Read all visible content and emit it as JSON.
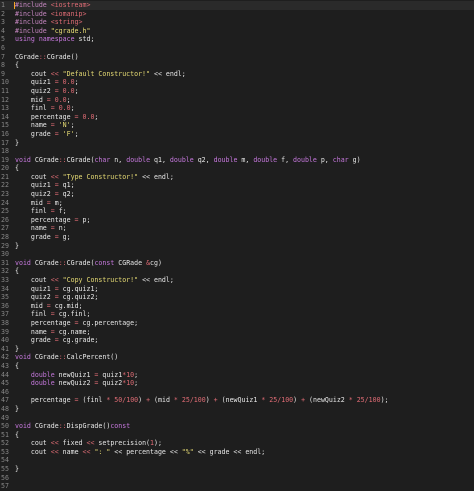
{
  "editor": {
    "theme": {
      "background": "#1e1e1e",
      "line_number": "#858585",
      "string": "#e6db74",
      "keyword": "#c678dd",
      "number": "#e06c75"
    },
    "lines": [
      [
        {
          "t": "#include ",
          "c": "pp"
        },
        {
          "t": "<iostream>",
          "c": "op"
        }
      ],
      [
        {
          "t": "#include ",
          "c": "pp"
        },
        {
          "t": "<iomanip>",
          "c": "op"
        }
      ],
      [
        {
          "t": "#include ",
          "c": "pp"
        },
        {
          "t": "<string>",
          "c": "op"
        }
      ],
      [
        {
          "t": "#include ",
          "c": "pp"
        },
        {
          "t": "\"cgrade.h\"",
          "c": "str"
        }
      ],
      [
        {
          "t": "using namespace ",
          "c": "kw2"
        },
        {
          "t": "std;",
          "c": "plain"
        }
      ],
      [],
      [
        {
          "t": "CGrade",
          "c": "plain"
        },
        {
          "t": "::",
          "c": "op"
        },
        {
          "t": "CGrade()",
          "c": "plain"
        }
      ],
      [
        {
          "t": "{",
          "c": "plain"
        }
      ],
      [
        {
          "t": "    cout ",
          "c": "plain"
        },
        {
          "t": "<< ",
          "c": "op"
        },
        {
          "t": "\"Default Constructor!\"",
          "c": "str"
        },
        {
          "t": " << endl;",
          "c": "plain"
        }
      ],
      [
        {
          "t": "    quiz1 ",
          "c": "plain"
        },
        {
          "t": "= ",
          "c": "op"
        },
        {
          "t": "0.0",
          "c": "num"
        },
        {
          "t": ";",
          "c": "plain"
        }
      ],
      [
        {
          "t": "    quiz2 ",
          "c": "plain"
        },
        {
          "t": "= ",
          "c": "op"
        },
        {
          "t": "0.0",
          "c": "num"
        },
        {
          "t": ";",
          "c": "plain"
        }
      ],
      [
        {
          "t": "    mid ",
          "c": "plain"
        },
        {
          "t": "= ",
          "c": "op"
        },
        {
          "t": "0.0",
          "c": "num"
        },
        {
          "t": ";",
          "c": "plain"
        }
      ],
      [
        {
          "t": "    finl ",
          "c": "plain"
        },
        {
          "t": "= ",
          "c": "op"
        },
        {
          "t": "0.0",
          "c": "num"
        },
        {
          "t": ";",
          "c": "plain"
        }
      ],
      [
        {
          "t": "    percentage ",
          "c": "plain"
        },
        {
          "t": "= ",
          "c": "op"
        },
        {
          "t": "0.0",
          "c": "num"
        },
        {
          "t": ";",
          "c": "plain"
        }
      ],
      [
        {
          "t": "    name ",
          "c": "plain"
        },
        {
          "t": "= ",
          "c": "op"
        },
        {
          "t": "'N'",
          "c": "str"
        },
        {
          "t": ";",
          "c": "plain"
        }
      ],
      [
        {
          "t": "    grade ",
          "c": "plain"
        },
        {
          "t": "= ",
          "c": "op"
        },
        {
          "t": "'F'",
          "c": "str"
        },
        {
          "t": ";",
          "c": "plain"
        }
      ],
      [
        {
          "t": "}",
          "c": "plain"
        }
      ],
      [],
      [
        {
          "t": "void ",
          "c": "kw2"
        },
        {
          "t": "CGrade",
          "c": "plain"
        },
        {
          "t": "::",
          "c": "op"
        },
        {
          "t": "CGrade(",
          "c": "plain"
        },
        {
          "t": "char ",
          "c": "kw2"
        },
        {
          "t": "n, ",
          "c": "plain"
        },
        {
          "t": "double ",
          "c": "kw2"
        },
        {
          "t": "q1, ",
          "c": "plain"
        },
        {
          "t": "double ",
          "c": "kw2"
        },
        {
          "t": "q2, ",
          "c": "plain"
        },
        {
          "t": "double ",
          "c": "kw2"
        },
        {
          "t": "m, ",
          "c": "plain"
        },
        {
          "t": "double ",
          "c": "kw2"
        },
        {
          "t": "f, ",
          "c": "plain"
        },
        {
          "t": "double ",
          "c": "kw2"
        },
        {
          "t": "p, ",
          "c": "plain"
        },
        {
          "t": "char ",
          "c": "kw2"
        },
        {
          "t": "g)",
          "c": "plain"
        }
      ],
      [
        {
          "t": "{",
          "c": "plain"
        }
      ],
      [
        {
          "t": "    cout ",
          "c": "plain"
        },
        {
          "t": "<< ",
          "c": "op"
        },
        {
          "t": "\"Type Constructor!\"",
          "c": "str"
        },
        {
          "t": " << endl;",
          "c": "plain"
        }
      ],
      [
        {
          "t": "    quiz1 ",
          "c": "plain"
        },
        {
          "t": "= ",
          "c": "op"
        },
        {
          "t": "q1;",
          "c": "plain"
        }
      ],
      [
        {
          "t": "    quiz2 ",
          "c": "plain"
        },
        {
          "t": "= ",
          "c": "op"
        },
        {
          "t": "q2;",
          "c": "plain"
        }
      ],
      [
        {
          "t": "    mid ",
          "c": "plain"
        },
        {
          "t": "= ",
          "c": "op"
        },
        {
          "t": "m;",
          "c": "plain"
        }
      ],
      [
        {
          "t": "    finl ",
          "c": "plain"
        },
        {
          "t": "= ",
          "c": "op"
        },
        {
          "t": "f;",
          "c": "plain"
        }
      ],
      [
        {
          "t": "    percentage ",
          "c": "plain"
        },
        {
          "t": "= ",
          "c": "op"
        },
        {
          "t": "p;",
          "c": "plain"
        }
      ],
      [
        {
          "t": "    name ",
          "c": "plain"
        },
        {
          "t": "= ",
          "c": "op"
        },
        {
          "t": "n;",
          "c": "plain"
        }
      ],
      [
        {
          "t": "    grade ",
          "c": "plain"
        },
        {
          "t": "= ",
          "c": "op"
        },
        {
          "t": "g;",
          "c": "plain"
        }
      ],
      [
        {
          "t": "}",
          "c": "plain"
        }
      ],
      [],
      [
        {
          "t": "void ",
          "c": "kw2"
        },
        {
          "t": "CGrade",
          "c": "plain"
        },
        {
          "t": "::",
          "c": "op"
        },
        {
          "t": "CGrade(",
          "c": "plain"
        },
        {
          "t": "const ",
          "c": "kw2"
        },
        {
          "t": "CGRade ",
          "c": "plain"
        },
        {
          "t": "&",
          "c": "op"
        },
        {
          "t": "cg)",
          "c": "plain"
        }
      ],
      [
        {
          "t": "{",
          "c": "plain"
        }
      ],
      [
        {
          "t": "    cout ",
          "c": "plain"
        },
        {
          "t": "<< ",
          "c": "op"
        },
        {
          "t": "\"Copy Constructor!\"",
          "c": "str"
        },
        {
          "t": " << endl;",
          "c": "plain"
        }
      ],
      [
        {
          "t": "    quiz1 ",
          "c": "plain"
        },
        {
          "t": "= ",
          "c": "op"
        },
        {
          "t": "cg.quiz1;",
          "c": "plain"
        }
      ],
      [
        {
          "t": "    quiz2 ",
          "c": "plain"
        },
        {
          "t": "= ",
          "c": "op"
        },
        {
          "t": "cg.quiz2;",
          "c": "plain"
        }
      ],
      [
        {
          "t": "    mid ",
          "c": "plain"
        },
        {
          "t": "= ",
          "c": "op"
        },
        {
          "t": "cg.mid;",
          "c": "plain"
        }
      ],
      [
        {
          "t": "    finl ",
          "c": "plain"
        },
        {
          "t": "= ",
          "c": "op"
        },
        {
          "t": "cg.finl;",
          "c": "plain"
        }
      ],
      [
        {
          "t": "    percentage ",
          "c": "plain"
        },
        {
          "t": "= ",
          "c": "op"
        },
        {
          "t": "cg.percentage;",
          "c": "plain"
        }
      ],
      [
        {
          "t": "    name ",
          "c": "plain"
        },
        {
          "t": "= ",
          "c": "op"
        },
        {
          "t": "cg.name;",
          "c": "plain"
        }
      ],
      [
        {
          "t": "    grade ",
          "c": "plain"
        },
        {
          "t": "= ",
          "c": "op"
        },
        {
          "t": "cg.grade;",
          "c": "plain"
        }
      ],
      [
        {
          "t": "}",
          "c": "plain"
        }
      ],
      [
        {
          "t": "void ",
          "c": "kw2"
        },
        {
          "t": "CGrade",
          "c": "plain"
        },
        {
          "t": "::",
          "c": "op"
        },
        {
          "t": "CalcPercent()",
          "c": "plain"
        }
      ],
      [
        {
          "t": "{",
          "c": "plain"
        }
      ],
      [
        {
          "t": "    double ",
          "c": "kw2"
        },
        {
          "t": "newQuiz1 ",
          "c": "plain"
        },
        {
          "t": "= ",
          "c": "op"
        },
        {
          "t": "quiz1",
          "c": "plain"
        },
        {
          "t": "*",
          "c": "op"
        },
        {
          "t": "10",
          "c": "num"
        },
        {
          "t": ";",
          "c": "plain"
        }
      ],
      [
        {
          "t": "    double ",
          "c": "kw2"
        },
        {
          "t": "newQuiz2 ",
          "c": "plain"
        },
        {
          "t": "= ",
          "c": "op"
        },
        {
          "t": "quiz2",
          "c": "plain"
        },
        {
          "t": "*",
          "c": "op"
        },
        {
          "t": "10",
          "c": "num"
        },
        {
          "t": ";",
          "c": "plain"
        }
      ],
      [],
      [
        {
          "t": "    percentage ",
          "c": "plain"
        },
        {
          "t": "= ",
          "c": "op"
        },
        {
          "t": "(finl ",
          "c": "plain"
        },
        {
          "t": "* ",
          "c": "op"
        },
        {
          "t": "50",
          "c": "num"
        },
        {
          "t": "/",
          "c": "op"
        },
        {
          "t": "100",
          "c": "num"
        },
        {
          "t": ") ",
          "c": "plain"
        },
        {
          "t": "+ ",
          "c": "op"
        },
        {
          "t": "(mid ",
          "c": "plain"
        },
        {
          "t": "* ",
          "c": "op"
        },
        {
          "t": "25",
          "c": "num"
        },
        {
          "t": "/",
          "c": "op"
        },
        {
          "t": "100",
          "c": "num"
        },
        {
          "t": ") ",
          "c": "plain"
        },
        {
          "t": "+ ",
          "c": "op"
        },
        {
          "t": "(newQuiz1 ",
          "c": "plain"
        },
        {
          "t": "* ",
          "c": "op"
        },
        {
          "t": "25",
          "c": "num"
        },
        {
          "t": "/",
          "c": "op"
        },
        {
          "t": "100",
          "c": "num"
        },
        {
          "t": ") ",
          "c": "plain"
        },
        {
          "t": "+ ",
          "c": "op"
        },
        {
          "t": "(newQuiz2 ",
          "c": "plain"
        },
        {
          "t": "* ",
          "c": "op"
        },
        {
          "t": "25",
          "c": "num"
        },
        {
          "t": "/",
          "c": "op"
        },
        {
          "t": "100",
          "c": "num"
        },
        {
          "t": ");",
          "c": "plain"
        }
      ],
      [
        {
          "t": "}",
          "c": "plain"
        }
      ],
      [],
      [
        {
          "t": "void ",
          "c": "kw2"
        },
        {
          "t": "CGrade",
          "c": "plain"
        },
        {
          "t": "::",
          "c": "op"
        },
        {
          "t": "DispGrade()",
          "c": "plain"
        },
        {
          "t": "const",
          "c": "kw2"
        }
      ],
      [
        {
          "t": "{",
          "c": "plain"
        }
      ],
      [
        {
          "t": "    cout ",
          "c": "plain"
        },
        {
          "t": "<< ",
          "c": "op"
        },
        {
          "t": "fixed ",
          "c": "plain"
        },
        {
          "t": "<< ",
          "c": "op"
        },
        {
          "t": "setprecision(",
          "c": "plain"
        },
        {
          "t": "1",
          "c": "num"
        },
        {
          "t": ");",
          "c": "plain"
        }
      ],
      [
        {
          "t": "    cout ",
          "c": "plain"
        },
        {
          "t": "<< ",
          "c": "op"
        },
        {
          "t": "name ",
          "c": "plain"
        },
        {
          "t": "<< ",
          "c": "op"
        },
        {
          "t": "\": \"",
          "c": "str"
        },
        {
          "t": " << percentage << ",
          "c": "plain"
        },
        {
          "t": "\"%\"",
          "c": "str"
        },
        {
          "t": " << grade << endl;",
          "c": "plain"
        }
      ],
      [],
      [
        {
          "t": "}",
          "c": "plain"
        }
      ],
      [],
      []
    ]
  }
}
